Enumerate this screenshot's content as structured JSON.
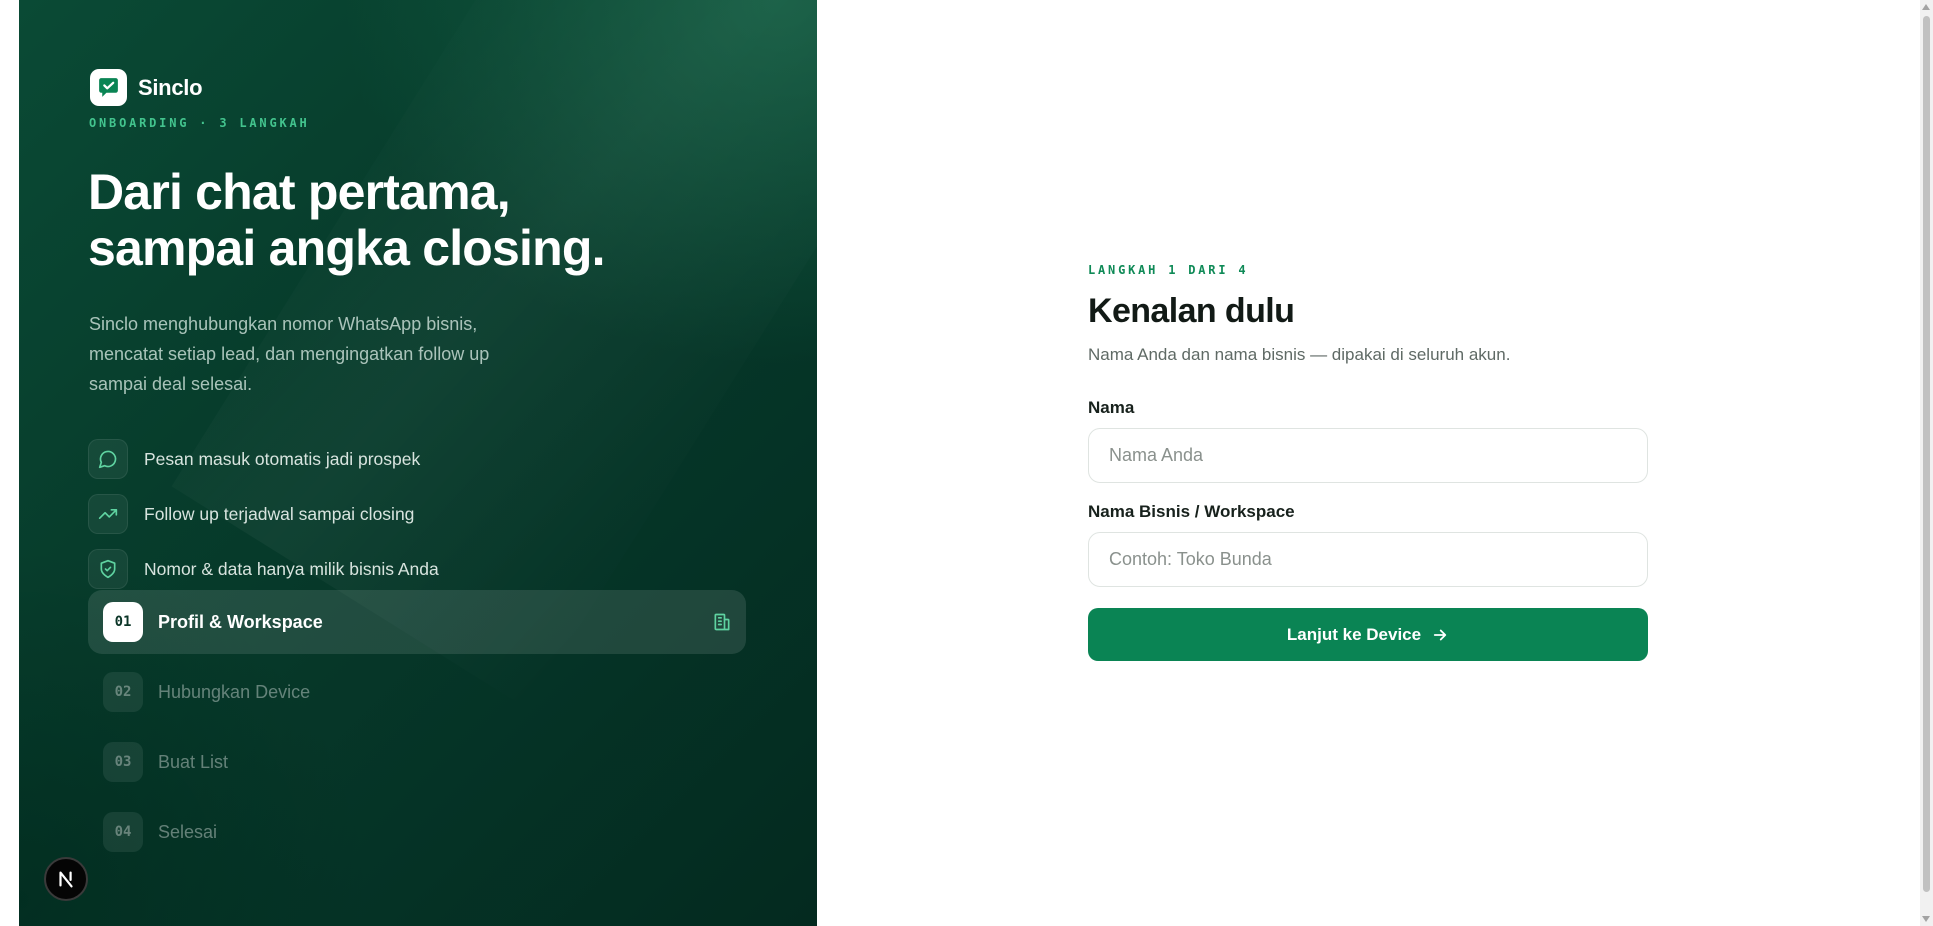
{
  "colors": {
    "brand_green": "#0a8454",
    "panel_dark": "#053326",
    "accent_mint": "#43c48e"
  },
  "brand": {
    "name": "Sinclo",
    "logo_icon": "chat-check-icon"
  },
  "hero": {
    "eyebrow": "ONBOARDING · 3 LANGKAH",
    "headline_line1": "Dari chat pertama,",
    "headline_line2": "sampai angka closing.",
    "subtext": "Sinclo menghubungkan nomor WhatsApp bisnis, mencatat setiap lead, dan mengingatkan follow up sampai deal selesai."
  },
  "features": [
    {
      "icon": "message-icon",
      "text": "Pesan masuk otomatis jadi prospek"
    },
    {
      "icon": "trending-up-icon",
      "text": "Follow up terjadwal sampai closing"
    },
    {
      "icon": "shield-check-icon",
      "text": "Nomor & data hanya milik bisnis Anda"
    }
  ],
  "steps": [
    {
      "number": "01",
      "label": "Profil & Workspace",
      "active": true,
      "trailing_icon": "building-icon"
    },
    {
      "number": "02",
      "label": "Hubungkan Device",
      "active": false
    },
    {
      "number": "03",
      "label": "Buat List",
      "active": false
    },
    {
      "number": "04",
      "label": "Selesai",
      "active": false
    }
  ],
  "form": {
    "step_indicator": "LANGKAH 1 DARI 4",
    "title": "Kenalan dulu",
    "description": "Nama Anda dan nama bisnis — dipakai di seluruh akun.",
    "name_label": "Nama",
    "name_placeholder": "Nama Anda",
    "name_value": "",
    "business_label": "Nama Bisnis / Workspace",
    "business_placeholder": "Contoh: Toko Bunda",
    "business_value": "",
    "submit_label": "Lanjut ke Device",
    "submit_icon": "arrow-right-icon"
  },
  "dev_badge": {
    "letter": "N"
  }
}
